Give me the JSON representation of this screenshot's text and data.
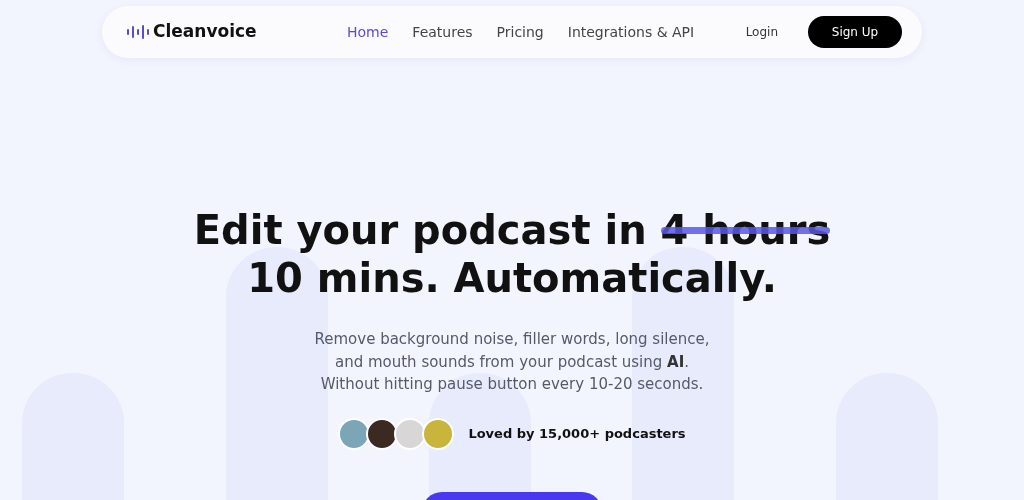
{
  "navbar": {
    "brand": "Cleanvoice",
    "links": [
      {
        "label": "Home",
        "selected": true
      },
      {
        "label": "Features",
        "selected": false
      },
      {
        "label": "Pricing",
        "selected": false
      },
      {
        "label": "Integrations & API",
        "selected": false
      }
    ],
    "login": "Login",
    "signup": "Sign Up"
  },
  "hero": {
    "headline_start": "Edit your podcast in",
    "headline_struck": "4 hours",
    "headline_end": "10 mins. Automatically.",
    "subtitle": [
      "Remove background noise, filler words, long silence,",
      "and mouth sounds from your podcast using **AI**.",
      "Without hitting pause button every 10-20 seconds."
    ],
    "social_proof": "Loved by 15,000+ podcasters"
  }
}
